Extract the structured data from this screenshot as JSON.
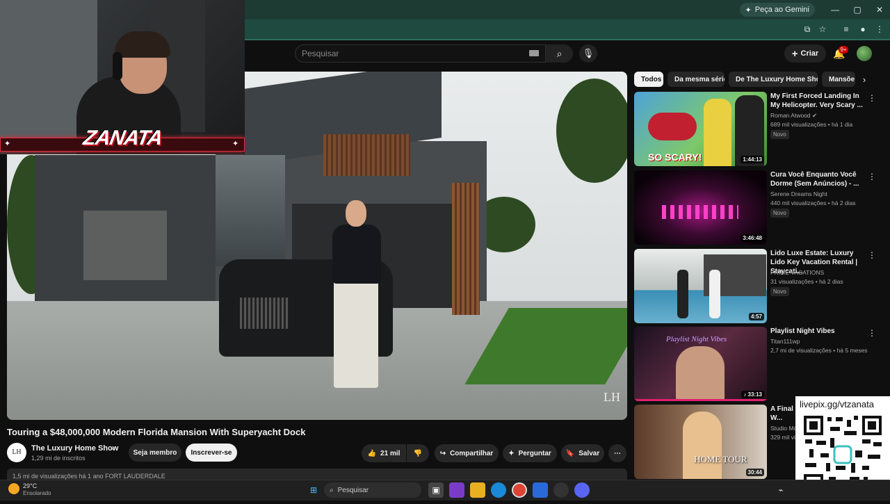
{
  "browser": {
    "gemini_label": "Peça ao Gemini",
    "window_controls": [
      "—",
      "▢",
      "✕"
    ]
  },
  "header": {
    "search_placeholder": "Pesquisar",
    "create_label": "Criar",
    "notifications_badge": "9+"
  },
  "webcam": {
    "overlay_name": "ZANATA"
  },
  "video": {
    "title": "Touring a $48,000,000 Modern Florida Mansion With Superyacht Dock",
    "watermark": "LH",
    "channel_avatar": "LH",
    "channel_name": "The Luxury Home Show",
    "subscribers": "1,29 mi de inscritos",
    "member_label": "Seja membro",
    "subscribe_label": "Inscrever-se",
    "likes": "21 mil",
    "share_label": "Compartilhar",
    "ask_label": "Perguntar",
    "save_label": "Salvar",
    "description_preview": "1,5 mi de visualizações  há 1 ano  FORT LAUDERDALE"
  },
  "chips": [
    "Todos",
    "Da mesma série",
    "De The Luxury Home Show",
    "Mansõe"
  ],
  "recommendations": [
    {
      "title": "My First Forced Landing In My Helicopter. Very Scary ...",
      "channel": "Roman Atwood",
      "verified": true,
      "meta": "689 mil visualizações  •  há 1 dia",
      "badge": "Novo",
      "duration": "1:44:13",
      "thumb_text": "SO SCARY!"
    },
    {
      "title": "Cura Você Enquanto Você Dorme (Sem Anúncios) - ...",
      "channel": "Serene Dreams Night",
      "verified": false,
      "meta": "440 mil visualizações  •  há 2 dias",
      "badge": "Novo",
      "duration": "3:46:48",
      "thumb_text": ""
    },
    {
      "title": "Lido Luxe Estate: Luxury Lido Key Vacation Rental | Staycati...",
      "channel": "PRIME VACATIONS",
      "verified": false,
      "meta": "31 visualizações  •  há 2 dias",
      "badge": "Novo",
      "duration": "4:57",
      "thumb_text": ""
    },
    {
      "title": "Playlist Night Vibes",
      "channel": "Titan111wp",
      "verified": false,
      "meta": "2,7 mi de visualizações  •  há 5 meses",
      "badge": "",
      "duration": "♪ 33:13",
      "thumb_text": "Playlist Night Vibes"
    },
    {
      "title": "A Final W... Oxford R...",
      "channel": "Studio Mc...",
      "verified": false,
      "meta": "329 mil vi...",
      "badge": "",
      "duration": "30:44",
      "thumb_text": "HOME TOUR"
    }
  ],
  "overlay": {
    "qr_caption": "livepix.gg/vtzanata"
  },
  "taskbar": {
    "weather_temp": "29°C",
    "weather_desc": "Ensolarado",
    "search_label": "Pesquisar"
  }
}
